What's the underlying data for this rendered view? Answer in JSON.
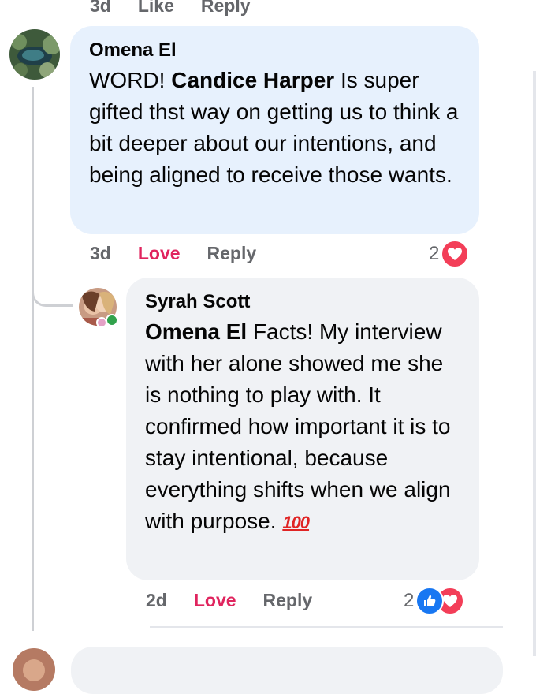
{
  "top_actions": {
    "time": "3d",
    "like": "Like",
    "reply": "Reply"
  },
  "comment1": {
    "author": "Omena El",
    "text_before": "WORD! ",
    "mention": "Candice Harper",
    "text_after": " Is super gifted thst way on getting us to think a bit deeper about our intentions, and being aligned to receive those wants.",
    "time": "3d",
    "reaction_label": "Love",
    "reply": "Reply",
    "reaction_count": "2",
    "reaction_icons": [
      "heart-icon"
    ]
  },
  "comment2": {
    "author": "Syrah Scott",
    "mention": "Omena El",
    "text_after": " Facts! My interview with her alone showed me she is nothing to play with. It confirmed how important it is to stay intentional, because everything shifts when we align with purpose. ",
    "emoji": "💯",
    "time": "2d",
    "reaction_label": "Love",
    "reply": "Reply",
    "reaction_count": "2",
    "reaction_icons": [
      "like-icon",
      "heart-icon"
    ]
  },
  "colors": {
    "love": "#e0245e",
    "like": "#1877f2",
    "heart": "#f33e58",
    "bubble_blue": "#e7f1fd",
    "bubble_gray": "#f0f2f5",
    "meta": "#65676b"
  }
}
